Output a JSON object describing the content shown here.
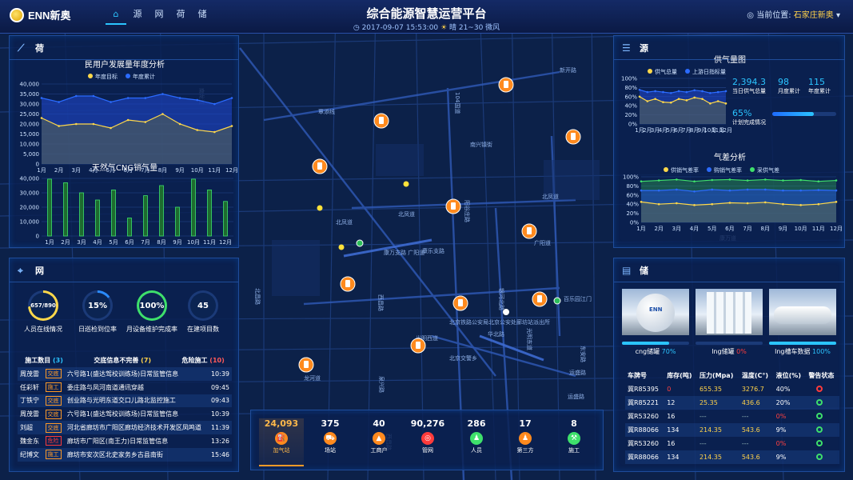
{
  "header": {
    "logo_text": "ENN新奥",
    "nav": [
      "源",
      "网",
      "荷",
      "储"
    ],
    "title": "综合能源智慧运营平台",
    "datetime": "2017-09-07  15:53:00",
    "weather": "晴 21~30 微风",
    "loc_label": "当前位置:",
    "loc_value": "石家庄新奥"
  },
  "map_labels": [
    "覃添线",
    "104国道",
    "南兴镇街",
    "北凤道",
    "北凤道",
    "阳谷庄路",
    "广阳道",
    "康乐支路",
    "康万支路 广阳道",
    "北凤道",
    "西昌路",
    "北京铁路公安局北京公安处廊坊站派出所",
    "光明西道",
    "北京交警乡",
    "百乐园江门",
    "光明东道",
    "东安路",
    "运盛路",
    "运盛路",
    "泉兴路",
    "银河北路",
    "华北路",
    "西昌路",
    "龙河道",
    "北昌路",
    "新华道",
    "北凤道",
    "北凤道",
    "广阳道",
    "南龙道",
    "康万道",
    "新开路"
  ],
  "he": {
    "title": "荷",
    "chart1": {
      "title": "民用户发展量年度分析",
      "legend": [
        "年度目标",
        "年度累计"
      ]
    },
    "chart2": {
      "title": "天然气CNG销气量"
    }
  },
  "chart_data": [
    {
      "type": "area",
      "title": "民用户发展量年度分析",
      "categories": [
        "1月",
        "2月",
        "3月",
        "4月",
        "5月",
        "6月",
        "7月",
        "8月",
        "9月",
        "10月",
        "11月",
        "12月"
      ],
      "ylim": [
        0,
        40000
      ],
      "yticks": [
        "0",
        "5,000",
        "10,000",
        "15,000",
        "20,000",
        "25,000",
        "30,000",
        "35,000",
        "40,000"
      ],
      "series": [
        {
          "name": "年度目标",
          "values": [
            23000,
            19000,
            20000,
            20000,
            18000,
            22000,
            21000,
            25000,
            20000,
            17000,
            16000,
            19000
          ]
        },
        {
          "name": "年度累计",
          "values": [
            33000,
            31000,
            34000,
            34000,
            31000,
            33000,
            33000,
            35000,
            33000,
            32000,
            30000,
            33000
          ]
        }
      ]
    },
    {
      "type": "bar",
      "title": "天然气CNG销气量",
      "categories": [
        "1月",
        "2月",
        "3月",
        "4月",
        "5月",
        "6月",
        "7月",
        "8月",
        "9月",
        "10月",
        "11月",
        "12月"
      ],
      "ylim": [
        0,
        40000
      ],
      "yticks": [
        "0",
        "10,000",
        "20,000",
        "30,000",
        "40,000"
      ],
      "values": [
        39500,
        37000,
        30000,
        25000,
        32000,
        12500,
        28000,
        35000,
        20000,
        39500,
        32000,
        24000
      ]
    },
    {
      "type": "area",
      "title": "供气量图",
      "categories": [
        "1月",
        "2月",
        "3月",
        "4月",
        "5月",
        "6月",
        "7月",
        "8月",
        "9月",
        "10月",
        "11月",
        "12月"
      ],
      "ylim": [
        0,
        100
      ],
      "yticks": [
        "0%",
        "20%",
        "40%",
        "60%",
        "80%",
        "100%"
      ],
      "series": [
        {
          "name": "供气总量",
          "values": [
            60,
            50,
            55,
            48,
            47,
            55,
            52,
            58,
            55,
            45,
            50,
            45
          ]
        },
        {
          "name": "上游日指标量",
          "values": [
            75,
            70,
            72,
            70,
            68,
            72,
            70,
            74,
            72,
            68,
            70,
            72
          ]
        }
      ]
    },
    {
      "type": "area",
      "title": "气差分析",
      "categories": [
        "1月",
        "2月",
        "3月",
        "4月",
        "5月",
        "6月",
        "7月",
        "8月",
        "9月",
        "10月",
        "11月",
        "12月"
      ],
      "ylim": [
        0,
        100
      ],
      "yticks": [
        "0%",
        "20%",
        "40%",
        "60%",
        "80%",
        "100%"
      ],
      "series": [
        {
          "name": "供销气差率",
          "values": [
            45,
            40,
            42,
            38,
            40,
            43,
            42,
            44,
            40,
            38,
            40,
            45
          ]
        },
        {
          "name": "购销气差率",
          "values": [
            70,
            70,
            72,
            68,
            72,
            70,
            72,
            72,
            70,
            70,
            71,
            70
          ]
        },
        {
          "name": "采供气差",
          "values": [
            90,
            92,
            94,
            90,
            93,
            94,
            92,
            94,
            92,
            93,
            90,
            92
          ]
        }
      ]
    }
  ],
  "yuan": {
    "title": "源",
    "chart_title": "供气量图",
    "legend": [
      "供气总量",
      "上游日指标量"
    ],
    "kpi": [
      {
        "value": "2,394.3",
        "label": "当日供气总量"
      },
      {
        "value": "98",
        "label": "月度累计"
      },
      {
        "value": "115",
        "label": "年度累计"
      }
    ],
    "plan": {
      "value": "65%",
      "label": "计划完成情况",
      "progress": 0.65
    },
    "chart2_title": "气差分析",
    "legend2": [
      "供销气差率",
      "购销气差率",
      "采供气差"
    ]
  },
  "wang": {
    "title": "网",
    "rings": [
      {
        "value": "657/890",
        "label": "人员在线情况",
        "progress": 0.74,
        "color": "#ffd84a"
      },
      {
        "value": "15%",
        "label": "日巡检到位率",
        "progress": 0.15,
        "color": "#2b8cff"
      },
      {
        "value": "100%",
        "label": "月设备维护完成率",
        "progress": 1.0,
        "color": "#3ee06b"
      },
      {
        "value": "45",
        "label": "在建项目数",
        "progress": 0.0,
        "color": "#5d7fbf"
      }
    ],
    "tabs": [
      {
        "label": "施工数目",
        "count": "(3)",
        "color": "#2bc4ff"
      },
      {
        "label": "交底信息不完善",
        "count": "(7)",
        "color": "#ffd24a"
      },
      {
        "label": "危险施工",
        "count": "(10)",
        "color": "#ff5a5a"
      }
    ],
    "rows": [
      {
        "name": "周茂雷",
        "tag": "交底",
        "red": false,
        "text": "六号路1(盛达驾校训练场)日常监管信息",
        "time": "10:39"
      },
      {
        "name": "任彩轩",
        "tag": "施工",
        "red": false,
        "text": "委庄路与凤河南道通讯穿越",
        "time": "09:45"
      },
      {
        "name": "丁铁宁",
        "tag": "交底",
        "red": false,
        "text": "创业路与光明东道交口儿路北监控施工",
        "time": "09:43"
      },
      {
        "name": "周茂雷",
        "tag": "交底",
        "red": false,
        "text": "六号路1(盛达驾校训练场)日常监管信息",
        "time": "10:39"
      },
      {
        "name": "刘超",
        "tag": "交底",
        "red": false,
        "text": "河北省廊坊市广阳区廊坊经济技术开发区凤鸣道",
        "time": "11:39"
      },
      {
        "name": "魏金东",
        "tag": "危险",
        "red": true,
        "text": "廊坊市广阳区(南王力)日常监管信息",
        "time": "13:26"
      },
      {
        "name": "纪博文",
        "tag": "施工",
        "red": false,
        "text": "廊坊市安次区北史家务乡古县南街",
        "time": "15:46"
      }
    ]
  },
  "bottom": {
    "stats": [
      {
        "value": "24,093",
        "label": "加气站",
        "active": true
      },
      {
        "value": "375",
        "label": "场站"
      },
      {
        "value": "40",
        "label": "工商户"
      },
      {
        "value": "90,276",
        "label": "管网"
      },
      {
        "value": "286",
        "label": "人员"
      },
      {
        "value": "17",
        "label": "第三方"
      },
      {
        "value": "8",
        "label": "施工"
      }
    ]
  },
  "chu": {
    "title": "储",
    "images": [
      {
        "label": "cng储罐",
        "value": "70%",
        "progress": 0.7,
        "color": "#2bc4ff"
      },
      {
        "label": "lng储罐",
        "value": "0%",
        "progress": 0.0,
        "color": "#ff3b3b"
      },
      {
        "label": "lng槽车数据",
        "value": "100%",
        "progress": 1.0,
        "color": "#2bc4ff"
      }
    ],
    "image_text": "ENN",
    "columns": [
      "车牌号",
      "库存(吨)",
      "压力(Mpa)",
      "温度(C°)",
      "液位(%)",
      "警告状态"
    ],
    "rows": [
      {
        "plate": "冀R85395",
        "stock": "0",
        "pressure": "655.35",
        "temp": "3276.7",
        "level": "40%",
        "stock_red": true,
        "warn": "red"
      },
      {
        "plate": "冀R85221",
        "stock": "12",
        "pressure": "25.35",
        "temp": "436.6",
        "level": "20%",
        "warn": "green"
      },
      {
        "plate": "冀R53260",
        "stock": "16",
        "pressure": "---",
        "temp": "---",
        "level": "0%",
        "level_red": true,
        "warn": "green"
      },
      {
        "plate": "冀R88066",
        "stock": "134",
        "pressure": "214.35",
        "temp": "543.6",
        "level": "9%",
        "warn": "green"
      },
      {
        "plate": "冀R53260",
        "stock": "16",
        "pressure": "---",
        "temp": "---",
        "level": "0%",
        "level_red": true,
        "warn": "green"
      },
      {
        "plate": "冀R88066",
        "stock": "134",
        "pressure": "214.35",
        "temp": "543.6",
        "level": "9%",
        "warn": "green"
      }
    ]
  }
}
